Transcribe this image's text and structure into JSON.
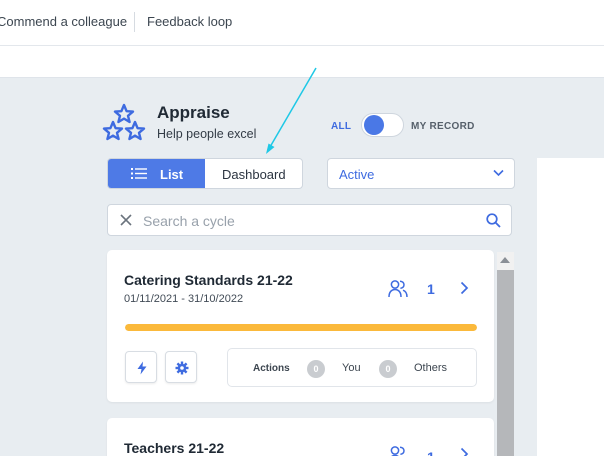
{
  "top_nav": {
    "commend_label": "Commend a colleague",
    "feedback_label": "Feedback loop"
  },
  "header": {
    "title": "Appraise",
    "subtitle": "Help people excel",
    "logo_icon": "stars-icon"
  },
  "record_toggle": {
    "left_label": "ALL",
    "right_label": "MY RECORD",
    "state": "ALL"
  },
  "view_switch": {
    "list_label": "List",
    "dashboard_label": "Dashboard",
    "selected": "List"
  },
  "status_select": {
    "value": "Active"
  },
  "search": {
    "placeholder": "Search a cycle"
  },
  "cycles": [
    {
      "title": "Catering Standards 21-22",
      "dates": "01/11/2021 - 31/10/2022",
      "participants": "1",
      "progress": 1.0,
      "stats": {
        "actions_label": "Actions",
        "you_count": "0",
        "you_label": "You",
        "others_count": "0",
        "others_label": "Others"
      }
    },
    {
      "title": "Teachers 21-22",
      "participants": "1"
    }
  ],
  "colors": {
    "accent": "#4e7ae6",
    "progress": "#fbb93b",
    "annotation": "#1ec8e6"
  }
}
